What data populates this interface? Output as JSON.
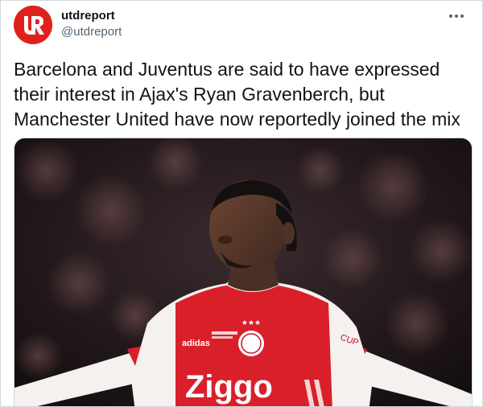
{
  "tweet": {
    "display_name": "utdreport",
    "handle": "@utdreport",
    "text": "Barcelona and Juventus are said to have expressed their interest in Ajax's Ryan Gravenberch, but Manchester United have now reportedly joined the mix",
    "more_icon": "more-horizontal-icon"
  },
  "avatar": {
    "letters": "UR",
    "color": "#e0201c"
  },
  "photo": {
    "shirt_sponsor": "Ziggo",
    "shirt_brand": "adidas",
    "sleeve_text": "CUP",
    "colors": {
      "shirt_red": "#d9202a",
      "shirt_white": "#f4f1ee",
      "skin": "#5a3a2c",
      "crowd": "#2a1c20"
    }
  }
}
